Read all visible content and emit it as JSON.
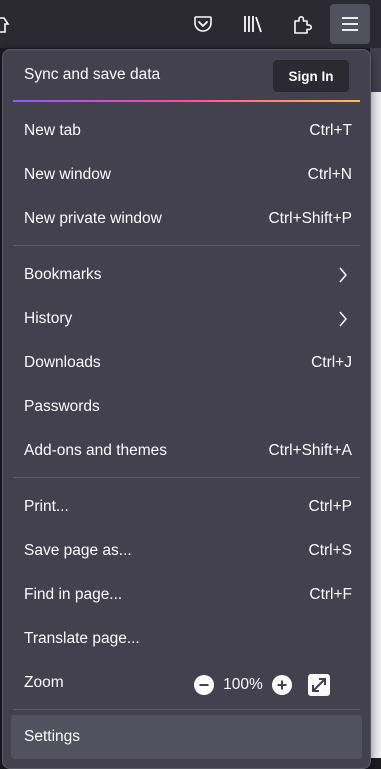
{
  "toolbar": {
    "buttons": [
      {
        "name": "pocket-icon"
      },
      {
        "name": "library-icon"
      },
      {
        "name": "extensions-icon"
      },
      {
        "name": "hamburger-menu-icon",
        "active": true
      }
    ]
  },
  "menu": {
    "sync": {
      "label": "Sync and save data",
      "signin_label": "Sign In"
    },
    "group1": [
      {
        "label": "New tab",
        "shortcut": "Ctrl+T"
      },
      {
        "label": "New window",
        "shortcut": "Ctrl+N"
      },
      {
        "label": "New private window",
        "shortcut": "Ctrl+Shift+P"
      }
    ],
    "group2": [
      {
        "label": "Bookmarks",
        "submenu": true
      },
      {
        "label": "History",
        "submenu": true
      },
      {
        "label": "Downloads",
        "shortcut": "Ctrl+J"
      },
      {
        "label": "Passwords",
        "shortcut": ""
      },
      {
        "label": "Add-ons and themes",
        "shortcut": "Ctrl+Shift+A"
      }
    ],
    "group3": [
      {
        "label": "Print...",
        "shortcut": "Ctrl+P"
      },
      {
        "label": "Save page as...",
        "shortcut": "Ctrl+S"
      },
      {
        "label": "Find in page...",
        "shortcut": "Ctrl+F"
      },
      {
        "label": "Translate page...",
        "shortcut": ""
      }
    ],
    "zoom": {
      "label": "Zoom",
      "value": "100%",
      "zoom_out_icon": "minus-icon",
      "zoom_in_icon": "plus-icon",
      "fullscreen_icon": "fullscreen-icon"
    },
    "settings": {
      "label": "Settings"
    }
  },
  "colors": {
    "panel_bg": "#42414d",
    "toolbar_bg": "#2b2a33",
    "text": "#fbfbfe",
    "hover": "#52525e",
    "separator": "#5b5b66"
  }
}
